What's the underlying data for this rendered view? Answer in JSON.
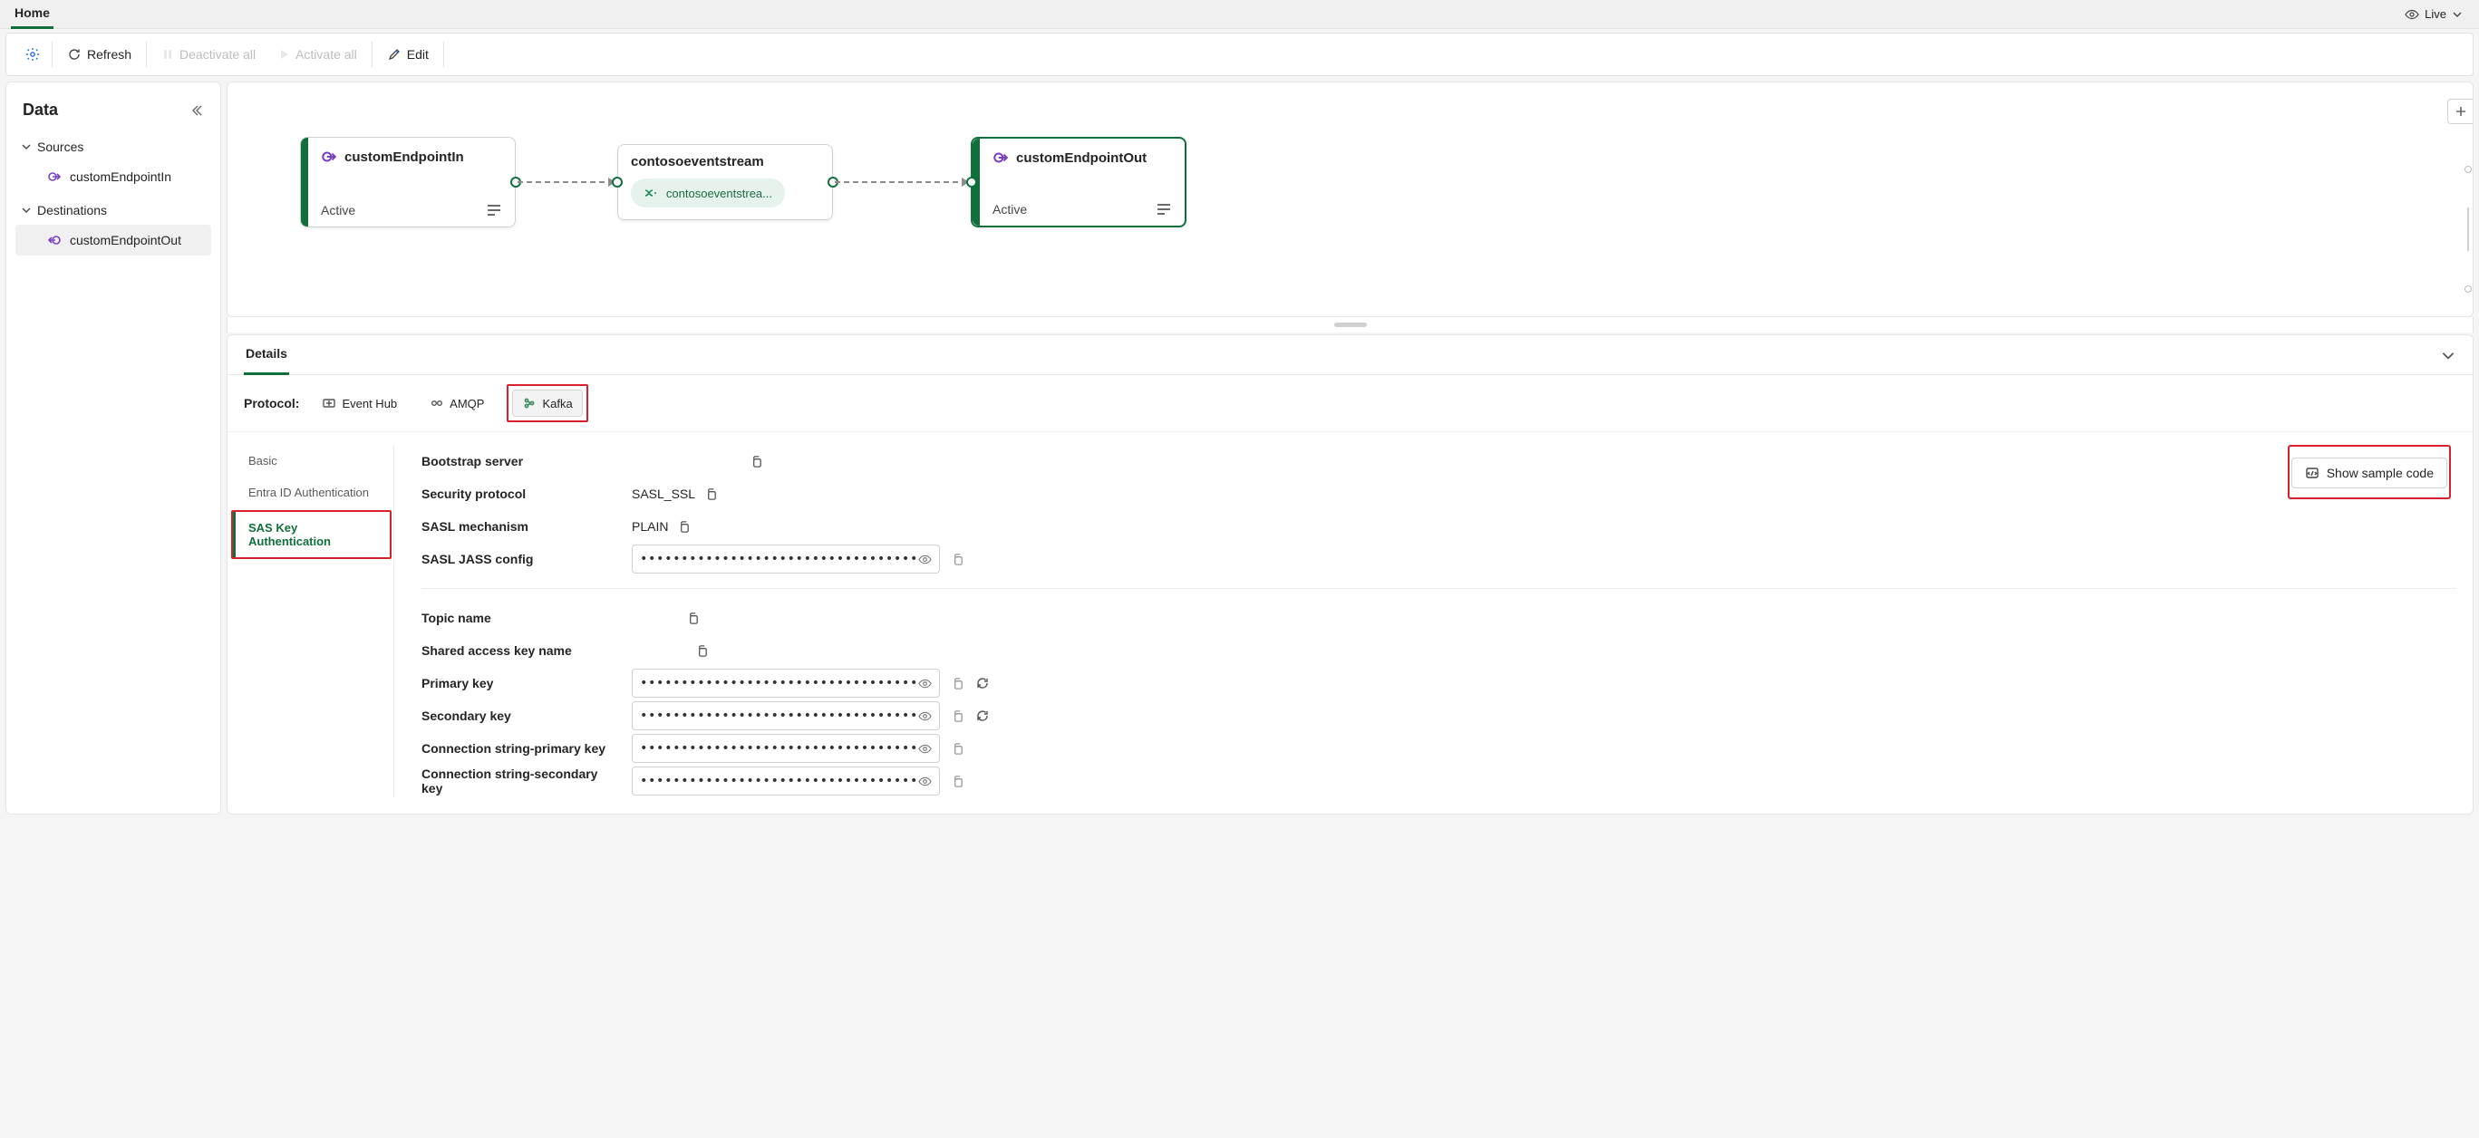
{
  "topTab": "Home",
  "live": {
    "label": "Live"
  },
  "toolbar": {
    "refresh": "Refresh",
    "deactivate_all": "Deactivate all",
    "activate_all": "Activate all",
    "edit": "Edit"
  },
  "sidebar": {
    "title": "Data",
    "sections": [
      {
        "heading": "Sources",
        "items": [
          {
            "label": "customEndpointIn",
            "icon": "endpoint-in-icon"
          }
        ]
      },
      {
        "heading": "Destinations",
        "items": [
          {
            "label": "customEndpointOut",
            "icon": "endpoint-out-icon",
            "selected": true
          }
        ]
      }
    ]
  },
  "canvas": {
    "nodes": {
      "input": {
        "title": "customEndpointIn",
        "status": "Active"
      },
      "stream": {
        "title": "contosoeventstream",
        "chip": "contosoeventstrea..."
      },
      "output": {
        "title": "customEndpointOut",
        "status": "Active"
      }
    }
  },
  "details": {
    "tab": "Details",
    "protocolLabel": "Protocol:",
    "protocols": [
      {
        "name": "Event Hub",
        "icon": "eventhub-icon"
      },
      {
        "name": "AMQP",
        "icon": "amqp-icon"
      },
      {
        "name": "Kafka",
        "icon": "kafka-icon",
        "active": true
      }
    ],
    "authNav": [
      {
        "label": "Basic"
      },
      {
        "label": "Entra ID Authentication"
      },
      {
        "label": "SAS Key Authentication",
        "active": true
      }
    ],
    "fields": {
      "bootstrap_server_label": "Bootstrap server",
      "bootstrap_server_value": "",
      "security_protocol_label": "Security protocol",
      "security_protocol_value": "SASL_SSL",
      "sasl_mech_label": "SASL mechanism",
      "sasl_mech_value": "PLAIN",
      "sasl_jass_label": "SASL JASS config",
      "topic_name_label": "Topic name",
      "topic_name_value": "",
      "sak_name_label": "Shared access key name",
      "sak_name_value": "",
      "primary_key_label": "Primary key",
      "secondary_key_label": "Secondary key",
      "cs_primary_label": "Connection string-primary key",
      "cs_secondary_label": "Connection string-secondary key",
      "masked": "•••••••••••••••••••••••••••••••••••••••••••••••••••••"
    },
    "sampleCode": "Show sample code"
  }
}
